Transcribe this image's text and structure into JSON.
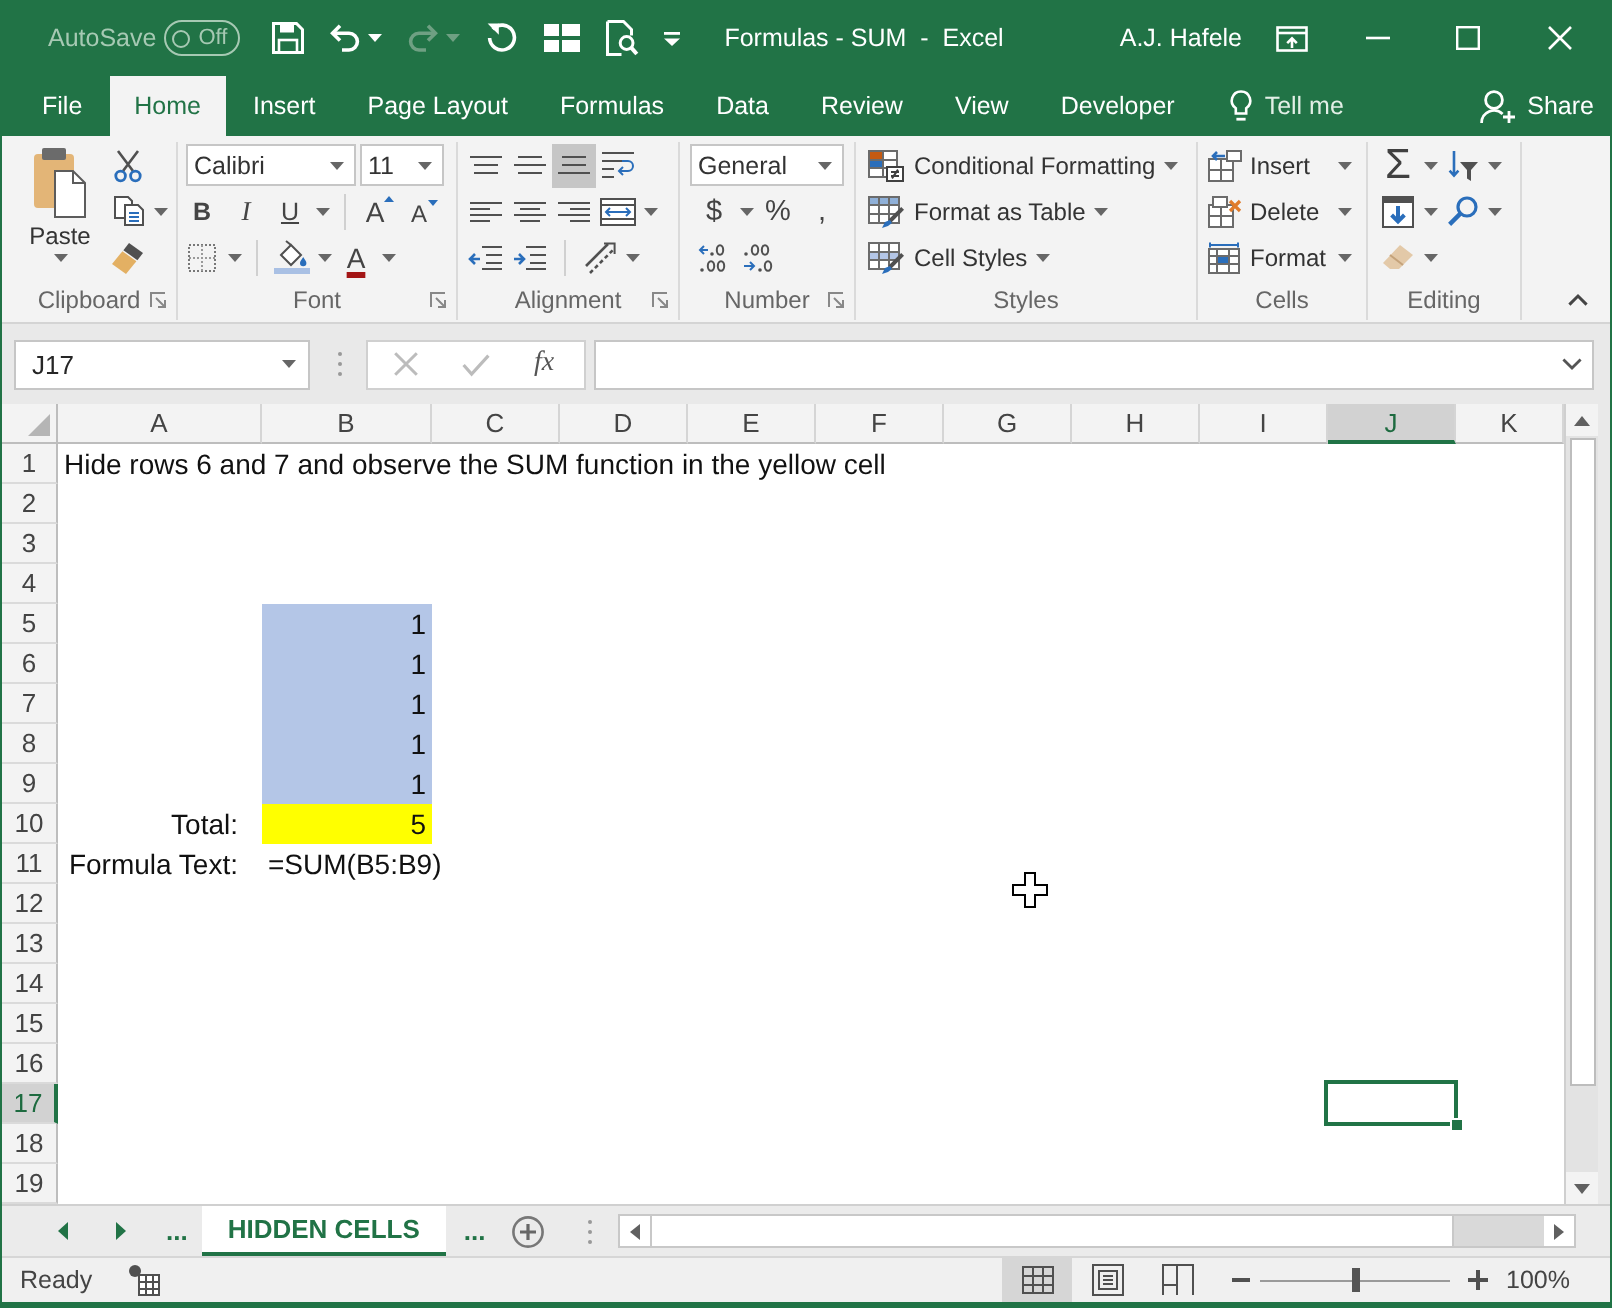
{
  "title_bar": {
    "autosave": {
      "label": "AutoSave",
      "state": "Off",
      "on": false
    },
    "quick_access": [
      {
        "kind": "save",
        "disabled": false
      },
      {
        "kind": "undo",
        "disabled": false
      },
      {
        "kind": "redo",
        "disabled": true
      },
      {
        "kind": "refresh",
        "disabled": false
      },
      {
        "kind": "form",
        "disabled": false
      },
      {
        "kind": "print-preview",
        "disabled": false
      },
      {
        "kind": "customize",
        "disabled": false
      }
    ],
    "title": "Formulas - SUM  -  Excel",
    "user": "A.J. Hafele"
  },
  "tabs": [
    {
      "label": "File",
      "selected": false
    },
    {
      "label": "Home",
      "selected": true
    },
    {
      "label": "Insert",
      "selected": false
    },
    {
      "label": "Page Layout",
      "selected": false
    },
    {
      "label": "Formulas",
      "selected": false
    },
    {
      "label": "Data",
      "selected": false
    },
    {
      "label": "Review",
      "selected": false
    },
    {
      "label": "View",
      "selected": false
    },
    {
      "label": "Developer",
      "selected": false
    }
  ],
  "tell_me": "Tell me",
  "share": "Share",
  "ribbon": {
    "groups": [
      {
        "kind": "clipboard",
        "label": "Clipboard",
        "launcher": true,
        "paste": "Paste"
      },
      {
        "kind": "font",
        "label": "Font",
        "launcher": true,
        "font": "Calibri",
        "size": "11",
        "bold": "B",
        "italic": "I",
        "underline": "U",
        "grow": "A",
        "shrink": "A",
        "font_color": "A"
      },
      {
        "kind": "alignment",
        "label": "Alignment",
        "launcher": true,
        "vertical": [
          {
            "kind": "top",
            "selected": false
          },
          {
            "kind": "middle",
            "selected": false
          },
          {
            "kind": "bottom",
            "selected": true
          }
        ]
      },
      {
        "kind": "number",
        "label": "Number",
        "launcher": true,
        "format": "General",
        "currency": "$",
        "percent": "%",
        "comma": ","
      },
      {
        "kind": "styles",
        "label": "Styles",
        "launcher": false,
        "commands": [
          {
            "kind": "conditional",
            "label": "Conditional Formatting"
          },
          {
            "kind": "table",
            "label": "Format as Table"
          },
          {
            "kind": "cell-styles",
            "label": "Cell Styles"
          }
        ]
      },
      {
        "kind": "cells",
        "label": "Cells",
        "launcher": false,
        "commands": [
          {
            "kind": "insert",
            "label": "Insert"
          },
          {
            "kind": "delete",
            "label": "Delete"
          },
          {
            "kind": "format",
            "label": "Format"
          }
        ]
      },
      {
        "kind": "editing",
        "label": "Editing",
        "launcher": false,
        "autosum": "Σ"
      }
    ]
  },
  "formula_bar": {
    "name_box": "J17",
    "function_label": "fx"
  },
  "sheet": {
    "columns": [
      {
        "label": "A",
        "selected": false
      },
      {
        "label": "B",
        "selected": false
      },
      {
        "label": "C",
        "selected": false
      },
      {
        "label": "D",
        "selected": false
      },
      {
        "label": "E",
        "selected": false
      },
      {
        "label": "F",
        "selected": false
      },
      {
        "label": "G",
        "selected": false
      },
      {
        "label": "H",
        "selected": false
      },
      {
        "label": "I",
        "selected": false
      },
      {
        "label": "J",
        "selected": true
      },
      {
        "label": "K",
        "selected": false
      }
    ],
    "rows": [
      {
        "label": "1",
        "selected": false,
        "cells": [
          {
            "kind": "text",
            "text": "Hide rows 6 and 7 and observe the SUM function in the yellow cell"
          }
        ]
      },
      {
        "label": "2",
        "selected": false
      },
      {
        "label": "3",
        "selected": false
      },
      {
        "label": "4",
        "selected": false
      },
      {
        "label": "5",
        "selected": false,
        "cells": [
          null,
          {
            "kind": "number",
            "text": "1",
            "color": "#b4c6e7"
          }
        ]
      },
      {
        "label": "6",
        "selected": false,
        "cells": [
          null,
          {
            "kind": "number",
            "text": "1",
            "color": "#b4c6e7"
          }
        ]
      },
      {
        "label": "7",
        "selected": false,
        "cells": [
          null,
          {
            "kind": "number",
            "text": "1",
            "color": "#b4c6e7"
          }
        ]
      },
      {
        "label": "8",
        "selected": false,
        "cells": [
          null,
          {
            "kind": "number",
            "text": "1",
            "color": "#b4c6e7"
          }
        ]
      },
      {
        "label": "9",
        "selected": false,
        "cells": [
          null,
          {
            "kind": "number",
            "text": "1",
            "color": "#b4c6e7"
          }
        ]
      },
      {
        "label": "10",
        "selected": false,
        "cells": [
          {
            "kind": "label",
            "text": "Total:"
          },
          {
            "kind": "number",
            "text": "5",
            "color": "#ffff00"
          }
        ]
      },
      {
        "label": "11",
        "selected": false,
        "cells": [
          {
            "kind": "label",
            "text": "Formula Text:"
          },
          {
            "kind": "text",
            "text": "=SUM(B5:B9)"
          }
        ]
      },
      {
        "label": "12",
        "selected": false
      },
      {
        "label": "13",
        "selected": false
      },
      {
        "label": "14",
        "selected": false
      },
      {
        "label": "15",
        "selected": false
      },
      {
        "label": "16",
        "selected": false
      },
      {
        "label": "17",
        "selected": true
      },
      {
        "label": "18",
        "selected": false
      },
      {
        "label": "19",
        "selected": false
      }
    ]
  },
  "sheet_tabs": {
    "more_left": "...",
    "tabs": [
      {
        "label": "HIDDEN CELLS",
        "selected": true
      }
    ],
    "more_right": "..."
  },
  "status_bar": {
    "status": "Ready",
    "views": [
      {
        "kind": "normal",
        "selected": true
      },
      {
        "kind": "page-layout",
        "selected": false
      },
      {
        "kind": "page-break",
        "selected": false
      }
    ],
    "zoom": {
      "level": 0.5,
      "reading": "100%"
    }
  }
}
